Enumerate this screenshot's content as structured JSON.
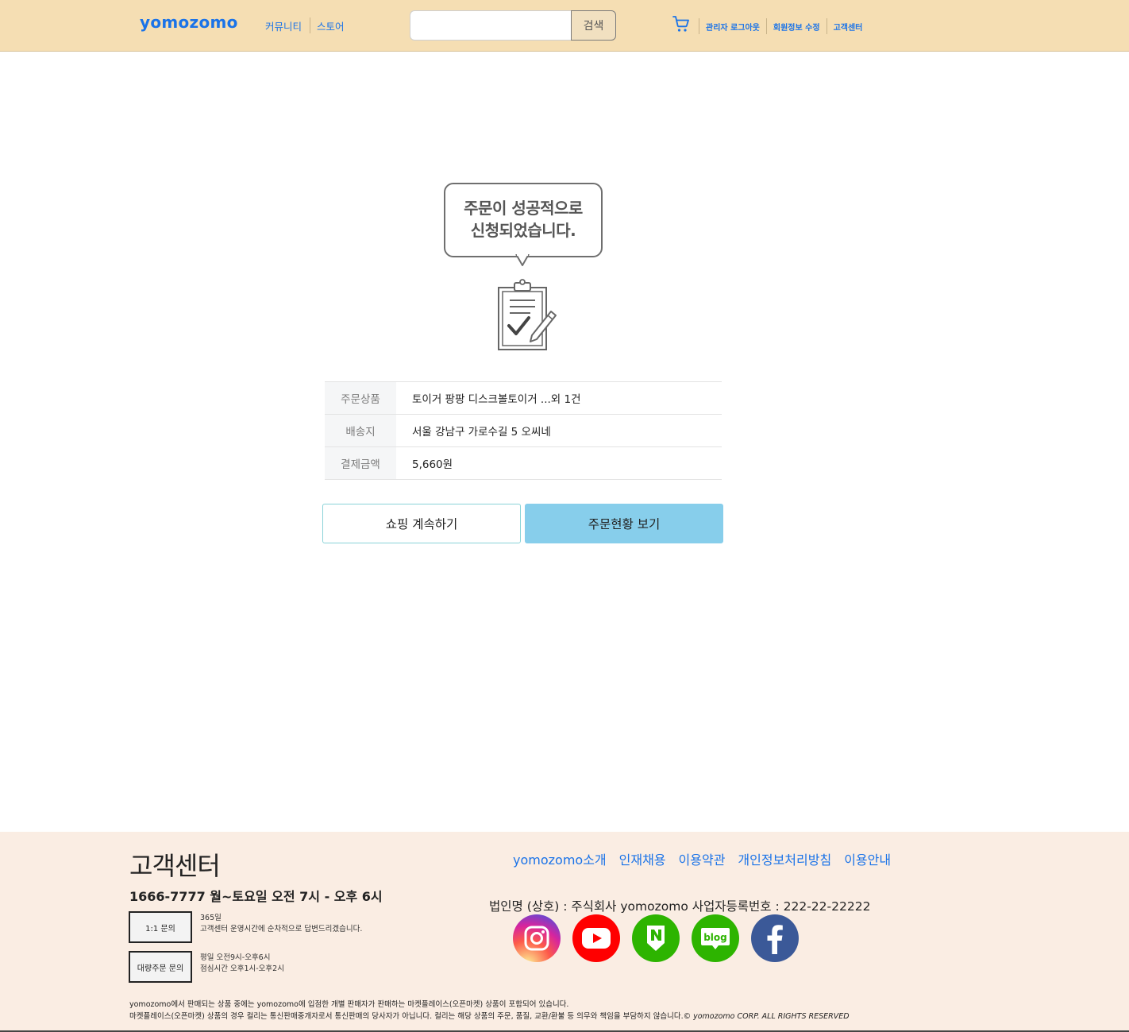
{
  "header": {
    "logo": "yomozomo",
    "nav": [
      "커뮤니티",
      "스토어"
    ],
    "search_placeholder": "",
    "search_button": "검색",
    "cart_icon": "cart-icon",
    "util_links": [
      "관리자 로그아웃",
      "회원정보 수정",
      "고객센터"
    ]
  },
  "main": {
    "bubble_line1": "주문이 성공적으로",
    "bubble_line2": "신청되었습니다.",
    "illustration_icon": "clipboard-check-icon",
    "order": {
      "product_label": "주문상품",
      "product_value": "토이거 팡팡 디스크볼토이거 ...외 1건",
      "address_label": "배송지",
      "address_value": "서울 강남구 가로수길 5 오씨네",
      "amount_label": "결제금액",
      "amount_value": "5,660원"
    },
    "btn_continue": "쇼핑 계속하기",
    "btn_orders": "주문현황 보기"
  },
  "footer": {
    "cs_title": "고객센터",
    "cs_phone": "1666-7777 월~토요일 오전 7시 - 오후 6시",
    "inquiry1_label": "1:1 문의",
    "inquiry1_line1": "365일",
    "inquiry1_line2": "고객센터 운영시간에 순차적으로 답변드리겠습니다.",
    "inquiry2_label": "대량주문 문의",
    "inquiry2_line1": "평일 오전9시-오후6시",
    "inquiry2_line2": "점심시간 오후1시-오후2시",
    "links": [
      "yomozomo소개",
      "인재채용",
      "이용약관",
      "개인정보처리방침",
      "이용안내"
    ],
    "corp_info": "법인명 (상호) : 주식회사 yomozomo 사업자등록번호 : 222-22-22222",
    "social_icons": [
      "instagram-icon",
      "youtube-icon",
      "naver-post-icon",
      "naver-blog-icon",
      "facebook-icon"
    ],
    "blog_text": "blog",
    "notice_line1": "yomozomo에서 판매되는 상품 중에는 yomozomo에 입점한 개별 판매자가 판매하는 마켓플레이스(오픈마켓) 상품이 포함되어 있습니다.",
    "notice_line2": "마켓플레이스(오픈마켓) 상품의 경우 컬리는 통신판매중개자로서 통신판매의 당사자가 아닙니다. 컬리는 해당 상품의 주문, 품질, 교환/환불 등 의무와 책임을 부담하지 않습니다.",
    "copyright": "© yomozomo CORP. ALL RIGHTS RESERVED"
  },
  "colors": {
    "header_bg": "#f5deb3",
    "link": "#1a73e8",
    "primary_button": "#87ceeb",
    "footer_bg": "#faede3"
  }
}
